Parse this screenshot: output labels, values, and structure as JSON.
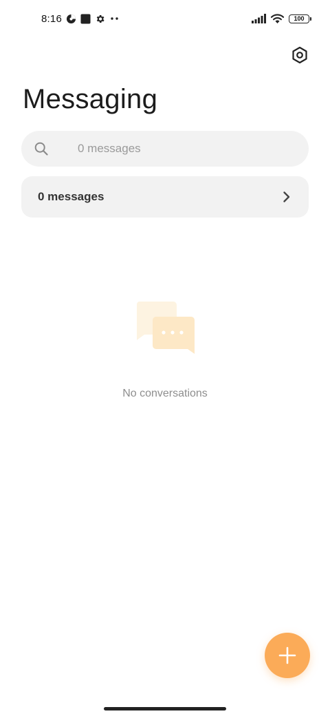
{
  "status_bar": {
    "time": "8:16",
    "battery": "100"
  },
  "header": {
    "title": "Messaging"
  },
  "search": {
    "placeholder": "0 messages"
  },
  "messages_card": {
    "label": "0 messages"
  },
  "empty_state": {
    "text": "No conversations"
  },
  "icons": {
    "settings": "hexagon-settings-icon",
    "search": "search-icon",
    "chevron": "chevron-right-icon",
    "fab": "plus-icon",
    "empty": "chat-bubbles-icon"
  },
  "colors": {
    "accent": "#fbab58",
    "card_background": "#f2f2f2",
    "empty_bubble_back": "#fdf3e1",
    "empty_bubble_front": "#fde8c6"
  }
}
